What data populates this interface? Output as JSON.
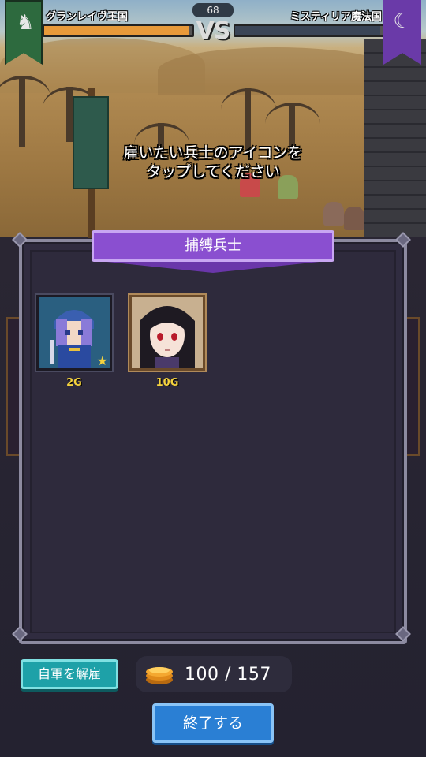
{
  "hud": {
    "left_kingdom": "グランレイヴ王国",
    "right_kingdom": "ミスティリア魔法国",
    "timer": "68",
    "vs": "VS",
    "left_icon": "lion-crest-icon",
    "right_icon": "crescent-moon-icon",
    "left_hp_fraction": 0.98,
    "right_hp_fraction": 0.98,
    "colors": {
      "left_bar": "#e89a3a",
      "right_bar": "#3a4556"
    }
  },
  "instruction": {
    "line1": "雇いたい兵士のアイコンを",
    "line2": "タップしてください"
  },
  "panel": {
    "title": "捕縛兵士",
    "units": [
      {
        "name": "blue-hooded-soldier",
        "price": "2G",
        "icon": "star-icon"
      },
      {
        "name": "dark-haired-girl",
        "price": "10G"
      }
    ]
  },
  "footer": {
    "dismiss_label": "自軍を解雇",
    "gold_display": "100 / 157",
    "gold_icon": "gold-coin-icon",
    "end_label": "終了する"
  }
}
